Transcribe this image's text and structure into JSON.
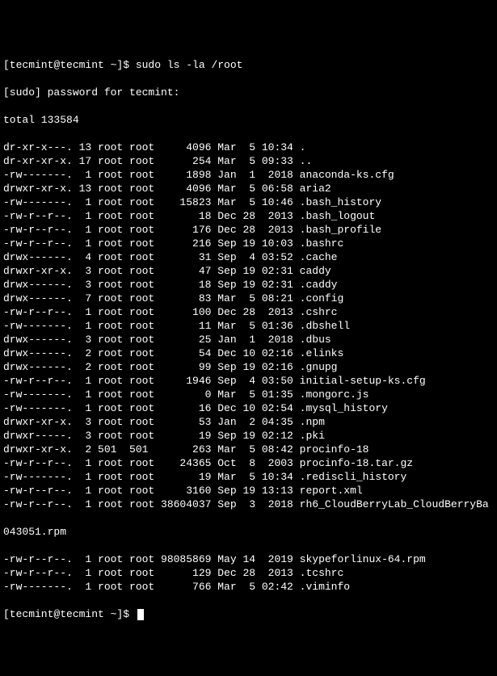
{
  "prompt1": "[tecmint@tecmint ~]$ sudo ls -la /root",
  "password_prompt": "[sudo] password for tecmint:",
  "total_line": "total 133584",
  "rows": [
    {
      "perm": "dr-xr-x---.",
      "links": "13",
      "user": "root",
      "group": "root",
      "size": "4096",
      "date": "Mar  5 10:34",
      "name": "."
    },
    {
      "perm": "dr-xr-xr-x.",
      "links": "17",
      "user": "root",
      "group": "root",
      "size": "254",
      "date": "Mar  5 09:33",
      "name": ".."
    },
    {
      "perm": "-rw-------.",
      "links": "1",
      "user": "root",
      "group": "root",
      "size": "1898",
      "date": "Jan  1  2018",
      "name": "anaconda-ks.cfg"
    },
    {
      "perm": "drwxr-xr-x.",
      "links": "13",
      "user": "root",
      "group": "root",
      "size": "4096",
      "date": "Mar  5 06:58",
      "name": "aria2"
    },
    {
      "perm": "-rw-------.",
      "links": "1",
      "user": "root",
      "group": "root",
      "size": "15823",
      "date": "Mar  5 10:46",
      "name": ".bash_history"
    },
    {
      "perm": "-rw-r--r--.",
      "links": "1",
      "user": "root",
      "group": "root",
      "size": "18",
      "date": "Dec 28  2013",
      "name": ".bash_logout"
    },
    {
      "perm": "-rw-r--r--.",
      "links": "1",
      "user": "root",
      "group": "root",
      "size": "176",
      "date": "Dec 28  2013",
      "name": ".bash_profile"
    },
    {
      "perm": "-rw-r--r--.",
      "links": "1",
      "user": "root",
      "group": "root",
      "size": "216",
      "date": "Sep 19 10:03",
      "name": ".bashrc"
    },
    {
      "perm": "drwx------.",
      "links": "4",
      "user": "root",
      "group": "root",
      "size": "31",
      "date": "Sep  4 03:52",
      "name": ".cache"
    },
    {
      "perm": "drwxr-xr-x.",
      "links": "3",
      "user": "root",
      "group": "root",
      "size": "47",
      "date": "Sep 19 02:31",
      "name": "caddy"
    },
    {
      "perm": "drwx------.",
      "links": "3",
      "user": "root",
      "group": "root",
      "size": "18",
      "date": "Sep 19 02:31",
      "name": ".caddy"
    },
    {
      "perm": "drwx------.",
      "links": "7",
      "user": "root",
      "group": "root",
      "size": "83",
      "date": "Mar  5 08:21",
      "name": ".config"
    },
    {
      "perm": "-rw-r--r--.",
      "links": "1",
      "user": "root",
      "group": "root",
      "size": "100",
      "date": "Dec 28  2013",
      "name": ".cshrc"
    },
    {
      "perm": "-rw-------.",
      "links": "1",
      "user": "root",
      "group": "root",
      "size": "11",
      "date": "Mar  5 01:36",
      "name": ".dbshell"
    },
    {
      "perm": "drwx------.",
      "links": "3",
      "user": "root",
      "group": "root",
      "size": "25",
      "date": "Jan  1  2018",
      "name": ".dbus"
    },
    {
      "perm": "drwx------.",
      "links": "2",
      "user": "root",
      "group": "root",
      "size": "54",
      "date": "Dec 10 02:16",
      "name": ".elinks"
    },
    {
      "perm": "drwx------.",
      "links": "2",
      "user": "root",
      "group": "root",
      "size": "99",
      "date": "Sep 19 02:16",
      "name": ".gnupg"
    },
    {
      "perm": "-rw-r--r--.",
      "links": "1",
      "user": "root",
      "group": "root",
      "size": "1946",
      "date": "Sep  4 03:50",
      "name": "initial-setup-ks.cfg"
    },
    {
      "perm": "-rw-------.",
      "links": "1",
      "user": "root",
      "group": "root",
      "size": "0",
      "date": "Mar  5 01:35",
      "name": ".mongorc.js"
    },
    {
      "perm": "-rw-------.",
      "links": "1",
      "user": "root",
      "group": "root",
      "size": "16",
      "date": "Dec 10 02:54",
      "name": ".mysql_history"
    },
    {
      "perm": "drwxr-xr-x.",
      "links": "3",
      "user": "root",
      "group": "root",
      "size": "53",
      "date": "Jan  2 04:35",
      "name": ".npm"
    },
    {
      "perm": "drwxr-----.",
      "links": "3",
      "user": "root",
      "group": "root",
      "size": "19",
      "date": "Sep 19 02:12",
      "name": ".pki"
    },
    {
      "perm": "drwxr-xr-x.",
      "links": "2",
      "user": "501",
      "group": "501",
      "size": "263",
      "date": "Mar  5 08:42",
      "name": "procinfo-18"
    },
    {
      "perm": "-rw-r--r--.",
      "links": "1",
      "user": "root",
      "group": "root",
      "size": "24365",
      "date": "Oct  8  2003",
      "name": "procinfo-18.tar.gz"
    },
    {
      "perm": "-rw-------.",
      "links": "1",
      "user": "root",
      "group": "root",
      "size": "19",
      "date": "Mar  5 10:34",
      "name": ".rediscli_history"
    },
    {
      "perm": "-rw-r--r--.",
      "links": "1",
      "user": "root",
      "group": "root",
      "size": "3160",
      "date": "Sep 19 13:13",
      "name": "report.xml"
    },
    {
      "perm": "-rw-r--r--.",
      "links": "1",
      "user": "root",
      "group": "root",
      "size": "38604037",
      "date": "Sep  3  2018",
      "name": "rh6_CloudBerryLab_CloudBerryBa"
    }
  ],
  "wrapped_line": "043051.rpm",
  "rows2": [
    {
      "perm": "-rw-r--r--.",
      "links": "1",
      "user": "root",
      "group": "root",
      "size": "98085869",
      "date": "May 14  2019",
      "name": "skypeforlinux-64.rpm"
    },
    {
      "perm": "-rw-r--r--.",
      "links": "1",
      "user": "root",
      "group": "root",
      "size": "129",
      "date": "Dec 28  2013",
      "name": ".tcshrc"
    },
    {
      "perm": "-rw-------.",
      "links": "1",
      "user": "root",
      "group": "root",
      "size": "766",
      "date": "Mar  5 02:42",
      "name": ".viminfo"
    }
  ],
  "prompt2": "[tecmint@tecmint ~]$ "
}
